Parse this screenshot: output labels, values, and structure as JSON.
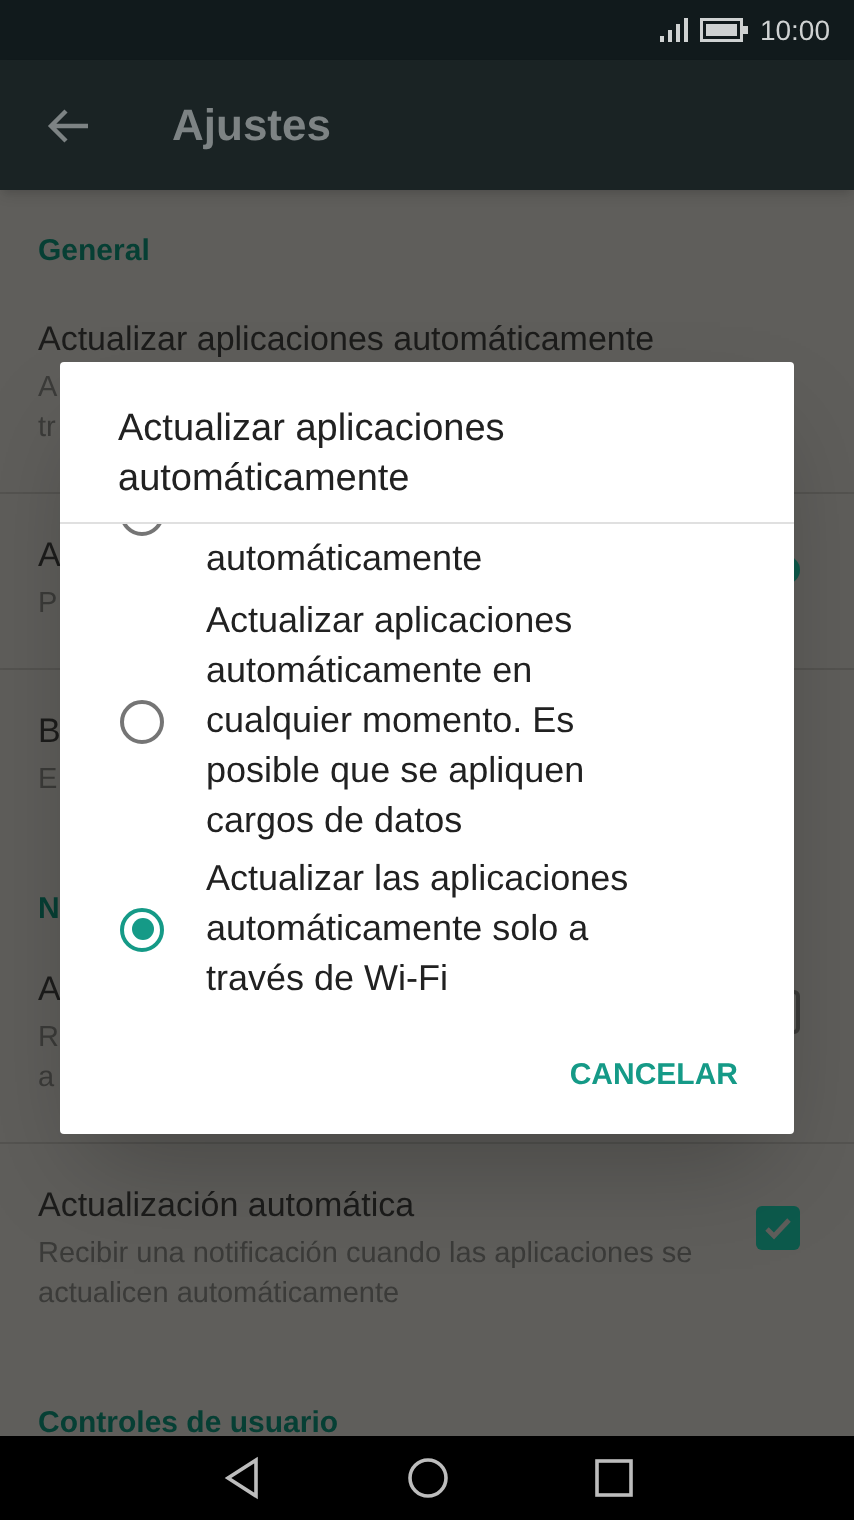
{
  "status_bar": {
    "time": "10:00"
  },
  "toolbar": {
    "title": "Ajustes"
  },
  "settings": [
    {
      "kind": "header",
      "text": "General"
    },
    {
      "kind": "row",
      "title": "Actualizar aplicaciones automáticamente",
      "subtitle": [
        "A",
        "tr"
      ]
    },
    {
      "kind": "row",
      "title": "A",
      "subtitle": [
        "P"
      ],
      "control": {
        "kind": "switch",
        "on": true
      }
    },
    {
      "kind": "row",
      "title": "B",
      "subtitle": [
        "E"
      ]
    },
    {
      "kind": "header",
      "text": "N"
    },
    {
      "kind": "row",
      "title": "A",
      "subtitle": [
        "R",
        "a"
      ],
      "control": {
        "kind": "checkbox",
        "checked": false
      }
    },
    {
      "kind": "row",
      "title": "Actualización automática",
      "subtitle": [
        "Recibir una notificación cuando las aplicaciones se actualicen automáticamente"
      ],
      "control": {
        "kind": "checkbox",
        "checked": true
      }
    },
    {
      "kind": "header",
      "text": "Controles de usuario"
    }
  ],
  "dialog": {
    "title": "Actualizar aplicaciones automáticamente",
    "options": [
      {
        "label": "automáticamente",
        "selected": false
      },
      {
        "label": "Actualizar aplicaciones automáticamente en cualquier momento. Es posible que se apliquen cargos de datos",
        "selected": false
      },
      {
        "label": "Actualizar las aplicaciones automáticamente solo a través de Wi-Fi",
        "selected": true
      }
    ],
    "button": "CANCELAR"
  }
}
